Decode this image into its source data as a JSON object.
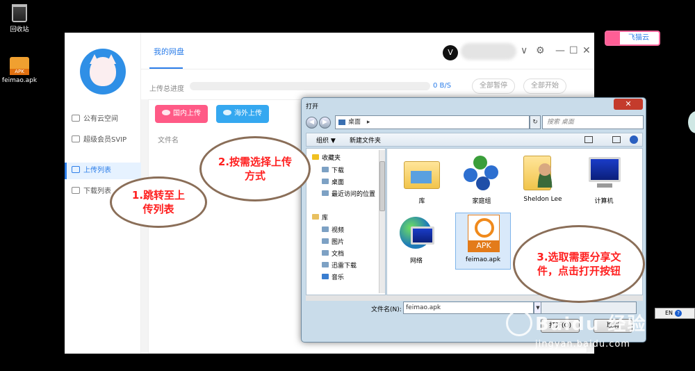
{
  "desktop": {
    "recycle_bin_label": "回收站",
    "apk_label": "feimao.apk",
    "apk_badge": "APK"
  },
  "brand": {
    "label": "飞猫云"
  },
  "app": {
    "sidebar": {
      "items": [
        {
          "label": "公有云空间",
          "icon": "cloud-icon"
        },
        {
          "label": "超级会员SVIP",
          "icon": "crown-icon"
        },
        {
          "label": "上传列表",
          "icon": "upload-icon",
          "active": true
        },
        {
          "label": "下载列表",
          "icon": "download-icon"
        }
      ]
    },
    "header": {
      "tab": "我的网盘",
      "user_initial": "V",
      "dropdown": "∨",
      "settings": "⚙",
      "minimize": "—",
      "maximize": "☐",
      "close": "✕"
    },
    "progress": {
      "label": "上传总进度",
      "speed": "0 B/S",
      "pause_all": "全部暂停",
      "start_all": "全部开始"
    },
    "upload_buttons": {
      "domestic": "国内上传",
      "overseas": "海外上传"
    },
    "columns": {
      "filename": "文件名"
    }
  },
  "dialog": {
    "title": "打开",
    "close": "✕",
    "back": "◀",
    "forward": "▶",
    "address": "桌面",
    "address_arrow": "▸",
    "refresh": "↻",
    "search_placeholder": "搜索 桌面",
    "toolbar": {
      "organize": "组织 ▼",
      "new_folder": "新建文件夹"
    },
    "tree": {
      "favorites": "收藏夹",
      "fav_items": [
        "下载",
        "桌面",
        "最近访问的位置"
      ],
      "libraries": "库",
      "lib_items": [
        "视频",
        "图片",
        "文档",
        "迅雷下载",
        "音乐"
      ]
    },
    "files": [
      {
        "name": "库",
        "icon": "library-folder-icon"
      },
      {
        "name": "家庭组",
        "icon": "homegroup-icon"
      },
      {
        "name": "Sheldon Lee",
        "icon": "user-folder-icon"
      },
      {
        "name": "计算机",
        "icon": "computer-icon"
      },
      {
        "name": "网络",
        "icon": "network-icon"
      },
      {
        "name": "feimao.apk",
        "icon": "apk-icon",
        "selected": true,
        "badge": "APK"
      }
    ],
    "filename_label": "文件名(N):",
    "filename_value": "feimao.apk",
    "open_button": "打开(O)",
    "cancel_button": "取消"
  },
  "annotations": {
    "step1": "1.跳转至上传列表",
    "step2": "2.按需选择上传方式",
    "step3": "3.选取需要分享文件，点击打开按钮"
  },
  "taskbar": {
    "ime": "EN",
    "help": "?"
  },
  "watermark": {
    "main": "Baidu 经验",
    "sub": "jingyan.baidu.com"
  },
  "colors": {
    "accent": "#2b7de9",
    "domestic_btn": "#ff5a86",
    "overseas_btn": "#35a8f0",
    "annotation_text": "#ff1f1f"
  }
}
